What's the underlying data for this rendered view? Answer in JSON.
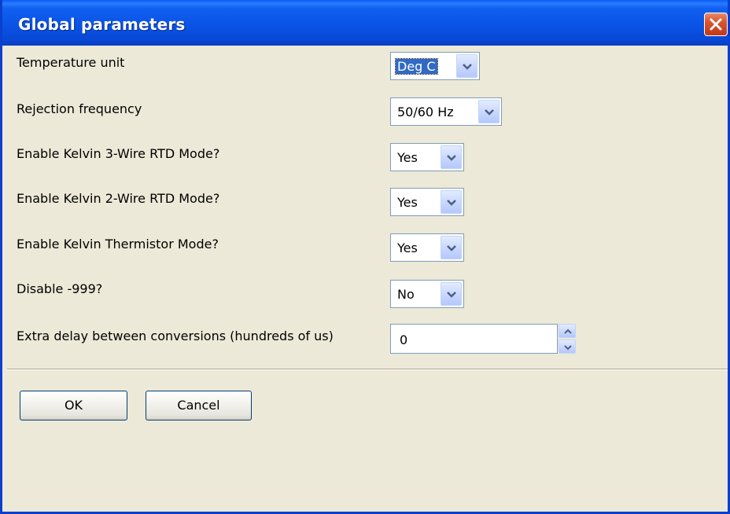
{
  "window": {
    "title": "Global parameters"
  },
  "form": {
    "temperature_unit": {
      "label": "Temperature unit",
      "value": "Deg C"
    },
    "rejection_frequency": {
      "label": "Rejection frequency",
      "value": "50/60 Hz"
    },
    "kelvin_3wire": {
      "label": "Enable Kelvin 3-Wire RTD Mode?",
      "value": "Yes"
    },
    "kelvin_2wire": {
      "label": "Enable Kelvin 2-Wire RTD Mode?",
      "value": "Yes"
    },
    "kelvin_thermistor": {
      "label": "Enable Kelvin Thermistor Mode?",
      "value": "Yes"
    },
    "disable_999": {
      "label": "Disable -999?",
      "value": "No"
    },
    "extra_delay": {
      "label": "Extra delay between conversions (hundreds of us)",
      "value": "0"
    }
  },
  "buttons": {
    "ok": "OK",
    "cancel": "Cancel"
  },
  "icons": {
    "close": "close-icon",
    "dropdown": "chevron-down-icon",
    "spin_up": "arrow-up-icon",
    "spin_down": "arrow-down-icon"
  },
  "colors": {
    "title_bar": "#0a55e8",
    "window_bg": "#ece9d8",
    "selection": "#316ac5",
    "close_button": "#d9542d"
  }
}
